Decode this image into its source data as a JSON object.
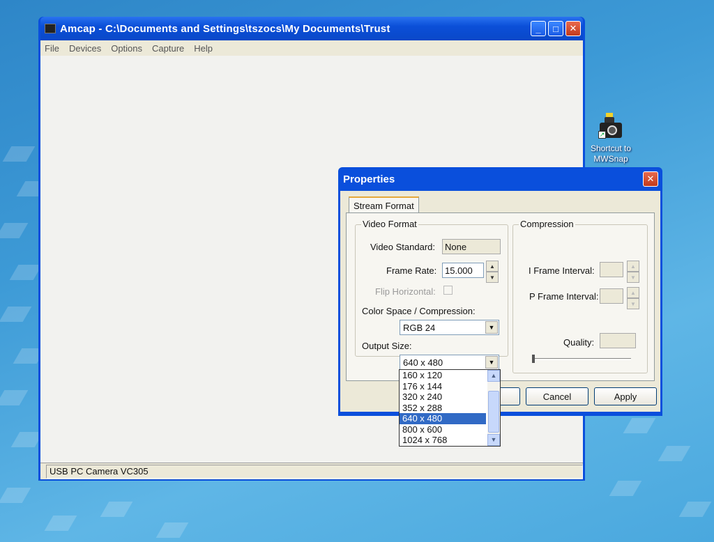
{
  "desktop": {
    "icon_label": "Shortcut to MWSnap"
  },
  "amcap": {
    "title": "Amcap - C:\\Documents and Settings\\tszocs\\My Documents\\Trust",
    "menu": [
      "File",
      "Devices",
      "Options",
      "Capture",
      "Help"
    ],
    "status": "USB PC Camera VC305",
    "controls": {
      "minimize": "_",
      "maximize": "□",
      "close": "✕"
    }
  },
  "properties": {
    "title": "Properties",
    "close": "✕",
    "tab": "Stream Format",
    "video_format": {
      "group_label": "Video Format",
      "video_standard_label": "Video Standard:",
      "video_standard_value": "None",
      "frame_rate_label": "Frame Rate:",
      "frame_rate_value": "15.000",
      "flip_label": "Flip Horizontal:",
      "color_space_label": "Color Space / Compression:",
      "color_space_value": "RGB 24",
      "output_size_label": "Output Size:",
      "output_size_value": "640 x 480"
    },
    "compression": {
      "group_label": "Compression",
      "i_frame_label": "I Frame Interval:",
      "p_frame_label": "P Frame Interval:",
      "quality_label": "Quality:"
    },
    "buttons": {
      "cancel": "Cancel",
      "apply": "Apply"
    }
  },
  "output_size_list": {
    "options": [
      "160 x 120",
      "176 x 144",
      "320 x 240",
      "352 x 288",
      "640 x 480",
      "800 x 600",
      "1024 x 768"
    ],
    "selected": "640 x 480"
  },
  "icons": {
    "spin_up": "▲",
    "spin_down": "▼",
    "dropdown": "▼",
    "scroll_up": "▲",
    "scroll_down": "▼"
  }
}
